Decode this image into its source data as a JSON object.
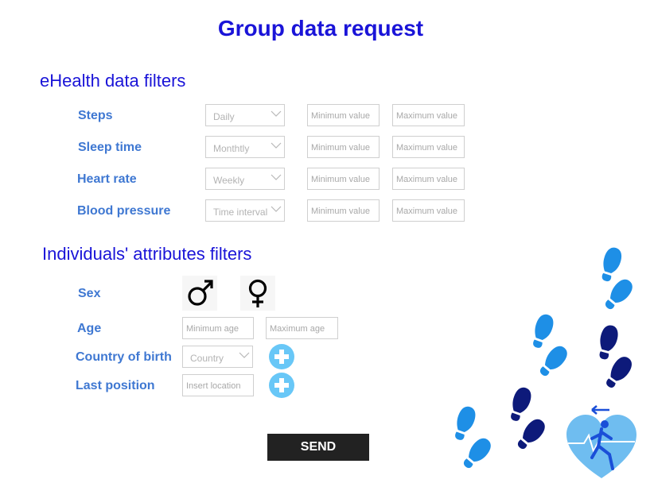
{
  "page": {
    "title": "Group data request",
    "send_label": "SEND"
  },
  "ehealth": {
    "heading": "eHealth data filters",
    "rows": [
      {
        "label": "Steps",
        "period": "Daily",
        "min_placeholder": "Minimum value",
        "max_placeholder": "Maximum value"
      },
      {
        "label": "Sleep time",
        "period": "Monthtly",
        "min_placeholder": "Minimum value",
        "max_placeholder": "Maximum value"
      },
      {
        "label": "Heart rate",
        "period": "Weekly",
        "min_placeholder": "Minimum value",
        "max_placeholder": "Maximum value"
      },
      {
        "label": "Blood pressure",
        "period": "Time interval",
        "min_placeholder": "Minimum value",
        "max_placeholder": "Maximum value"
      }
    ]
  },
  "attributes": {
    "heading": "Individuals' attributes filters",
    "sex": {
      "label": "Sex",
      "male_symbol": "♂",
      "female_symbol": "♀"
    },
    "age": {
      "label": "Age",
      "min_placeholder": "Minimum age",
      "max_placeholder": "Maximum age"
    },
    "country": {
      "label": "Country of birth",
      "select_value": "Country"
    },
    "position": {
      "label": "Last position",
      "placeholder": "Insert location"
    }
  },
  "colors": {
    "heading_blue": "#1a14d8",
    "label_blue": "#3f78d2",
    "plus_button": "#68c7f7",
    "send_button": "#222222",
    "footprint_light": "#1e8fe6",
    "footprint_dark": "#0d1a7a",
    "heart": "#6fbdf0"
  },
  "icons": [
    "chevron-down-icon",
    "male-symbol-icon",
    "female-symbol-icon",
    "plus-icon",
    "footprints-icon",
    "heart-runner-icon"
  ]
}
